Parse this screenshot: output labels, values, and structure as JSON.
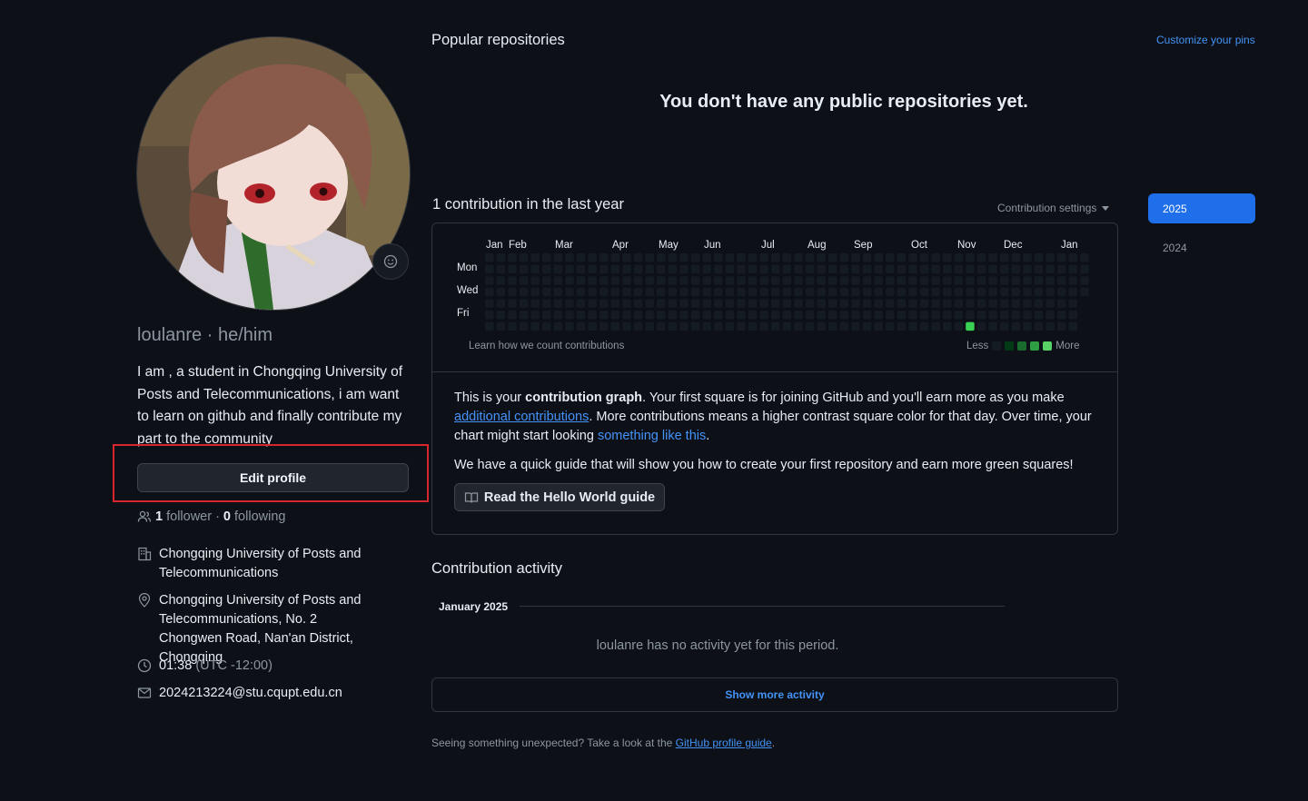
{
  "profile": {
    "username": "loulanre",
    "pronouns": "he/him",
    "bio": "I am , a student in Chongqing University of Posts and Telecommunications, i am want to learn on github and finally contribute my part to the community",
    "edit_label": "Edit profile",
    "followers_count": "1",
    "followers_label": "follower",
    "following_count": "0",
    "following_label": "following",
    "organization": "Chongqing University of Posts and Telecommunications",
    "location": "Chongqing University of Posts and Telecommunications, No. 2 Chongwen Road, Nan'an District, Chongqing",
    "local_time": "01:38",
    "timezone": "(UTC -12:00)",
    "email": "2024213224@stu.cqupt.edu.cn"
  },
  "popular": {
    "title": "Popular repositories",
    "customize_label": "Customize your pins",
    "empty_message": "You don't have any public repositories yet."
  },
  "contributions": {
    "title": "1 contribution in the last year",
    "settings_label": "Contribution settings",
    "months": [
      "Jan",
      "Feb",
      "Mar",
      "Apr",
      "May",
      "Jun",
      "Jul",
      "Aug",
      "Sep",
      "Oct",
      "Nov",
      "Dec",
      "Jan"
    ],
    "days": [
      "Mon",
      "Wed",
      "Fri"
    ],
    "learn_label": "Learn how we count contributions",
    "legend_less": "Less",
    "legend_more": "More",
    "active_week": 42,
    "active_day": 6,
    "info": {
      "p1_a": "This is your ",
      "p1_b": "contribution graph",
      "p1_c": ". Your first square is for joining GitHub and you'll earn more as you make ",
      "p1_link1": "additional contributions",
      "p1_d": ". More contributions means a higher contrast square color for that day. Over time, your chart might start looking ",
      "p1_link2": "something like this",
      "p1_e": ".",
      "p2": "We have a quick guide that will show you how to create your first repository and earn more green squares!",
      "guide_button": "Read the Hello World guide"
    }
  },
  "years": [
    "2025",
    "2024"
  ],
  "activity": {
    "title": "Contribution activity",
    "month": "January 2025",
    "empty": "loulanre has no activity yet for this period.",
    "show_more": "Show more activity"
  },
  "footer": {
    "text": "Seeing something unexpected? Take a look at the ",
    "link": "GitHub profile guide",
    "end": "."
  },
  "colors": {
    "background": "#0d1117",
    "accent": "#1f6feb",
    "link": "#4493f8",
    "empty_cell": "#151b23",
    "green_cell": "#39d353",
    "highlight_border": "#d9262c"
  }
}
